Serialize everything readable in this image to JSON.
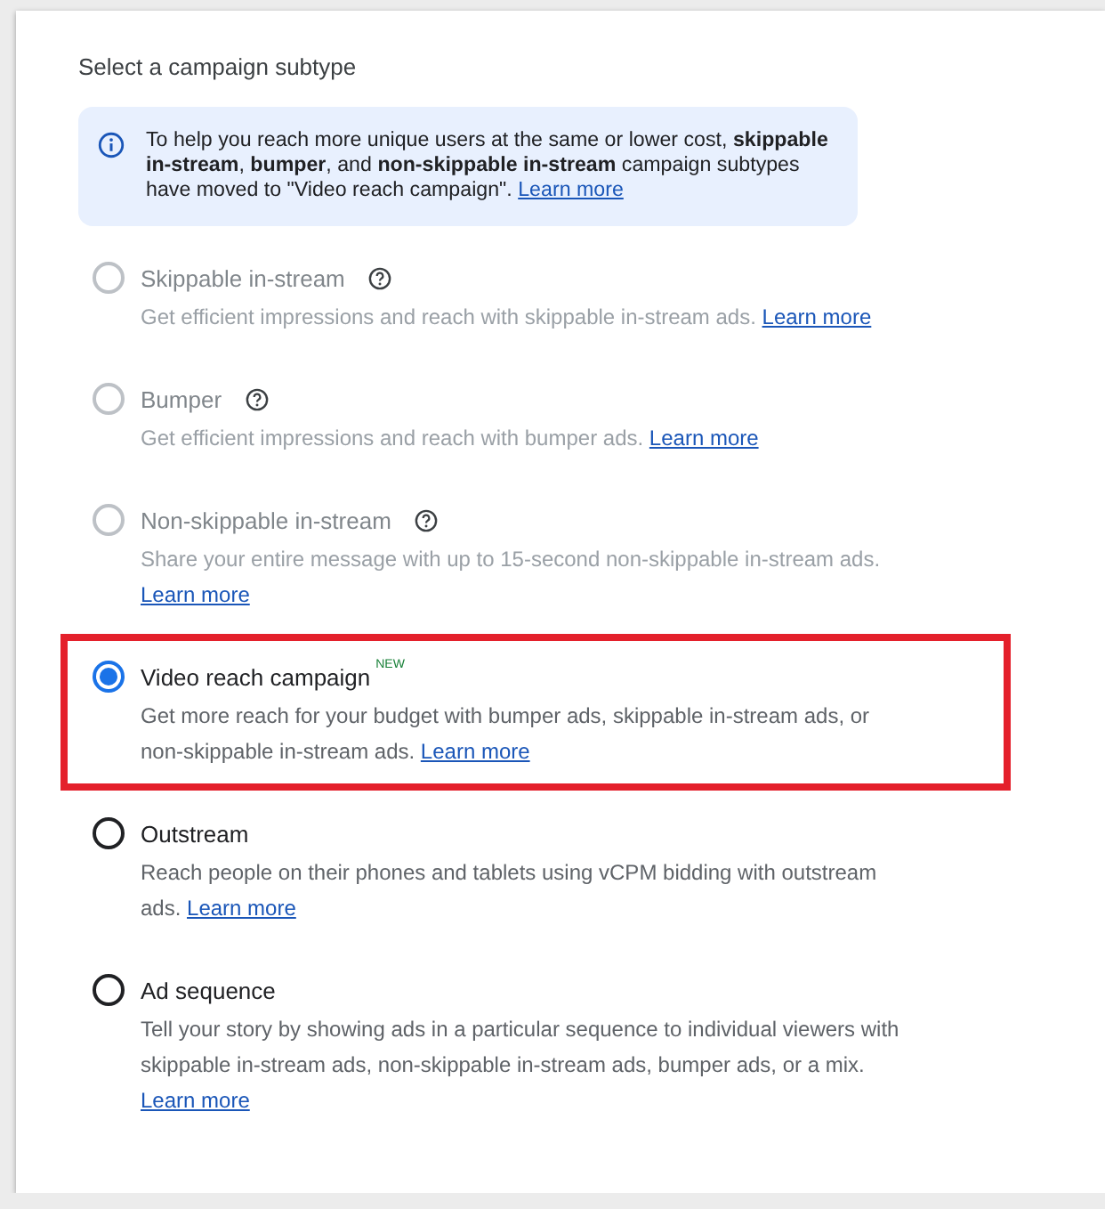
{
  "heading": "Select a campaign subtype",
  "notice": {
    "text": "To help you reach more unique users at the same or lower cost, **skippable in-stream**, **bumper**, and **non-skippable in-stream** campaign subtypes have moved to \"Video reach campaign\".",
    "link": "Learn more"
  },
  "options": [
    {
      "label": "Skippable in-stream",
      "help": true,
      "description": "Get efficient impressions and reach with skippable in-stream ads.",
      "link": "Learn more",
      "disabled": true,
      "selected": false,
      "highlighted": false
    },
    {
      "label": "Bumper",
      "help": true,
      "description": "Get efficient impressions and reach with bumper ads.",
      "link": "Learn more",
      "disabled": true,
      "selected": false,
      "highlighted": false
    },
    {
      "label": "Non-skippable in-stream",
      "help": true,
      "description": "Share your entire message with up to 15-second non-skippable in-stream ads.",
      "link": "Learn more",
      "disabled": true,
      "selected": false,
      "highlighted": false
    },
    {
      "label": "Video reach campaign",
      "help": false,
      "badge": "NEW",
      "description": "Get more reach for your budget with bumper ads, skippable in-stream ads, or non-skippable in-stream ads.",
      "link": "Learn more",
      "disabled": false,
      "selected": true,
      "highlighted": true
    },
    {
      "label": "Outstream",
      "help": false,
      "description": "Reach people on their phones and tablets using vCPM bidding with outstream ads.",
      "link": "Learn more",
      "disabled": false,
      "selected": false,
      "highlighted": false
    },
    {
      "label": "Ad sequence",
      "help": false,
      "description": "Tell your story by showing ads in a particular sequence to individual viewers with skippable in-stream ads, non-skippable in-stream ads, bumper ads, or a mix.",
      "link": "Learn more",
      "disabled": false,
      "selected": false,
      "highlighted": false
    }
  ]
}
